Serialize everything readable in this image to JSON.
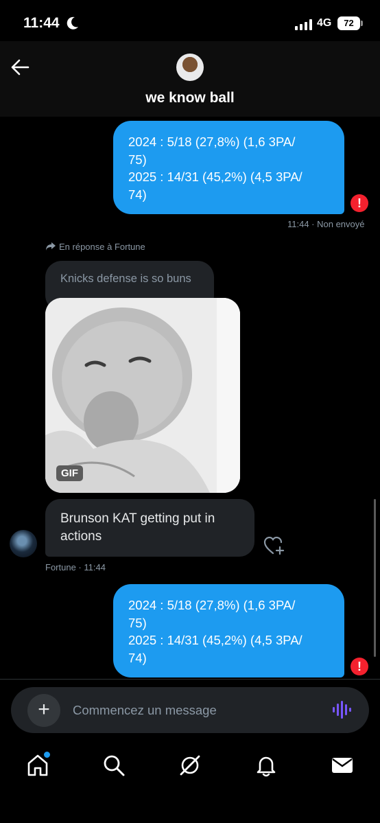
{
  "status_bar": {
    "time": "11:44",
    "network": "4G",
    "battery": "72"
  },
  "header": {
    "title": "we know ball"
  },
  "messages": {
    "first": {
      "lines": [
        "2024 : 5/18 (27,8%) (1,6 3PA/",
        "75)",
        "2025 : 14/31 (45,2%) (4,5 3PA/",
        "74)"
      ],
      "error": "!",
      "meta": "11:44 · Non envoyé"
    },
    "reply": {
      "label": "En réponse à Fortune",
      "quoted_text": "Knicks defense is so buns",
      "gif_badge": "GIF"
    },
    "incoming": {
      "lines": [
        "Brunson KAT getting put in",
        "actions"
      ],
      "meta": "Fortune · 11:44"
    },
    "second": {
      "lines": [
        "2024 : 5/18 (27,8%) (1,6 3PA/",
        "75)",
        "2025 : 14/31 (45,2%) (4,5 3PA/",
        "74)"
      ],
      "error": "!"
    }
  },
  "composer": {
    "placeholder": "Commencez un message"
  },
  "nav": {
    "icons": [
      "home-icon",
      "search-icon",
      "grok-icon",
      "notifications-icon",
      "messages-icon"
    ]
  },
  "colors": {
    "accent": "#1d9bf0",
    "error": "#f4212e",
    "bubble_in": "#202327"
  }
}
